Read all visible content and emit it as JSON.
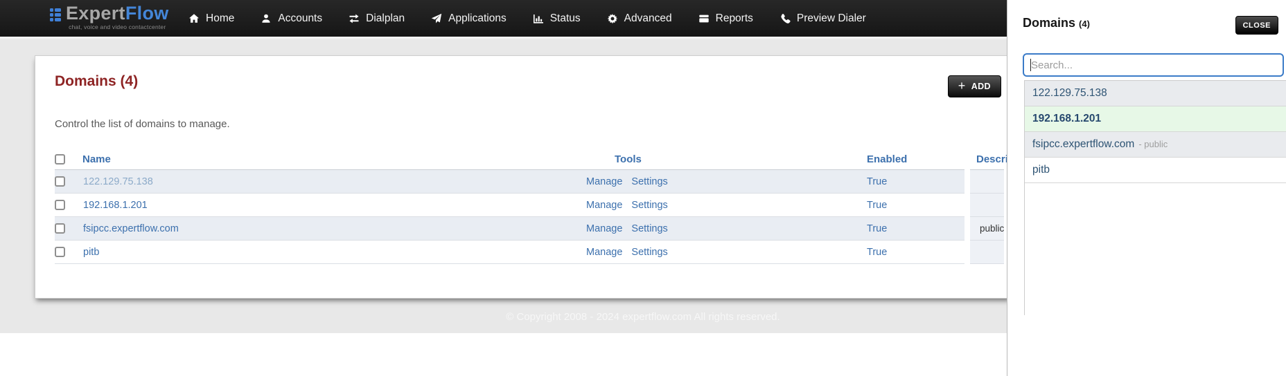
{
  "brand": {
    "name_primary": "Expert",
    "name_secondary": "Flow",
    "tagline": "chat, voice and video contactcenter"
  },
  "navbar": {
    "items": [
      {
        "label": "Home",
        "icon": "home"
      },
      {
        "label": "Accounts",
        "icon": "user"
      },
      {
        "label": "Dialplan",
        "icon": "swap"
      },
      {
        "label": "Applications",
        "icon": "send"
      },
      {
        "label": "Status",
        "icon": "bar-chart"
      },
      {
        "label": "Advanced",
        "icon": "gear"
      },
      {
        "label": "Reports",
        "icon": "window"
      },
      {
        "label": "Preview Dialer",
        "icon": "phone"
      }
    ]
  },
  "main": {
    "title": "Domains (4)",
    "subtitle": "Control the list of domains to manage.",
    "add_button": {
      "icon": "+",
      "label": "ADD"
    },
    "table": {
      "headers": [
        "Name",
        "Tools",
        "Enabled",
        "Description"
      ],
      "rows": [
        {
          "name": "122.129.75.138",
          "tools": [
            "Manage",
            "Settings"
          ],
          "enabled": "True",
          "description": "",
          "muted_name": true
        },
        {
          "name": "192.168.1.201",
          "tools": [
            "Manage",
            "Settings"
          ],
          "enabled": "True",
          "description": "",
          "muted_name": false
        },
        {
          "name": "fsipcc.expertflow.com",
          "tools": [
            "Manage",
            "Settings"
          ],
          "enabled": "True",
          "description": "public",
          "muted_name": false
        },
        {
          "name": "pitb",
          "tools": [
            "Manage",
            "Settings"
          ],
          "enabled": "True",
          "description": "",
          "muted_name": false
        }
      ]
    }
  },
  "footer": {
    "copyright": "© Copyright 2008 - 2024 expertflow.com All rights reserved."
  },
  "panel": {
    "title": "Domains",
    "count": "(4)",
    "close_label": "CLOSE",
    "search_placeholder": "Search...",
    "items": [
      {
        "label": "122.129.75.138",
        "suffix": "",
        "state": "striped"
      },
      {
        "label": "192.168.1.201",
        "suffix": "",
        "state": "selected"
      },
      {
        "label": "fsipcc.expertflow.com",
        "suffix": "- public",
        "state": "striped"
      },
      {
        "label": "pitb",
        "suffix": "",
        "state": "default"
      }
    ]
  },
  "colors": {
    "navbar_bg": "#1c1c1c",
    "brand_blue": "#4486d8",
    "title_red": "#8e2424",
    "link_blue": "#3c70ad",
    "muted_link_blue": "#8caac9",
    "striped_row_bg": "#e9edf3",
    "description_col_bg": "#eef1f6",
    "selected_item_green": "#e7f8e7",
    "panel_item_gray": "#e9ebee",
    "search_border_blue": "#3a7bc8",
    "page_bg_gray": "#e8e8e8",
    "button_black": "#0b0b0b"
  }
}
